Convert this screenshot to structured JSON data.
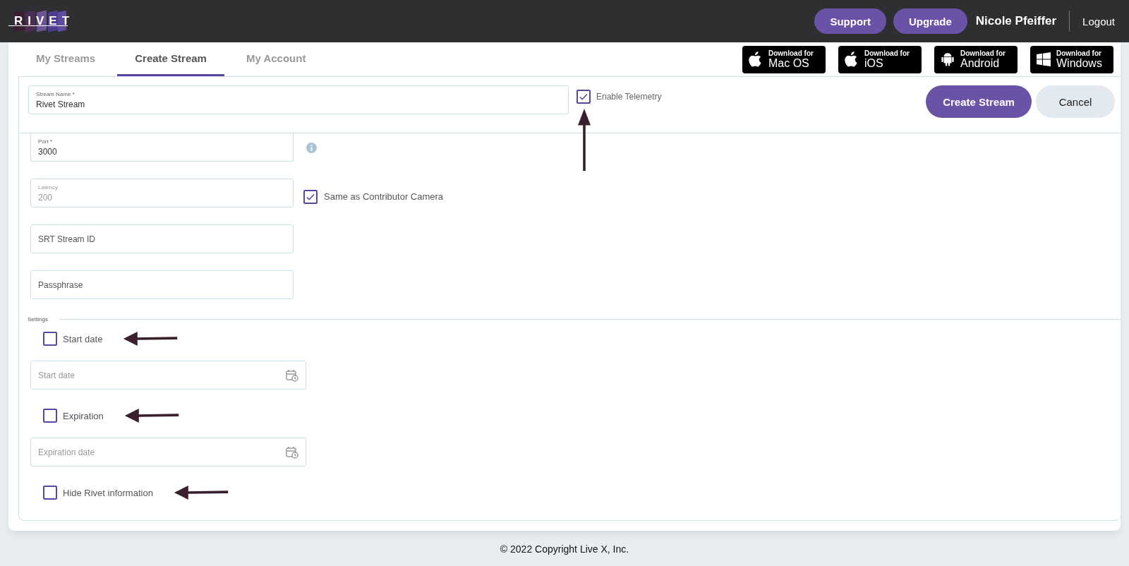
{
  "header": {
    "logo": "RIVET",
    "buttons": [
      {
        "label": "Support"
      },
      {
        "label": "Upgrade"
      }
    ],
    "user_name": "Nicole Pfeiffer",
    "logout": "Logout"
  },
  "tabs": [
    {
      "label": "My Streams",
      "selected": false
    },
    {
      "label": "Create Stream",
      "selected": true
    },
    {
      "label": "My Account",
      "selected": false
    }
  ],
  "downloads": [
    {
      "kind": "apple",
      "line1": "Download for",
      "line2": "Mac OS"
    },
    {
      "kind": "apple",
      "line1": "Download for",
      "line2": "iOS"
    },
    {
      "kind": "android",
      "line1": "Download for",
      "line2": "Android"
    },
    {
      "kind": "windows",
      "line1": "Download for",
      "line2": "Windows"
    }
  ],
  "stream_name": {
    "label": "Stream Name *",
    "value": "Rivet Stream"
  },
  "telemetry": {
    "label": "Enable Telemetry",
    "checked": true
  },
  "actions": [
    {
      "label": "Create Stream",
      "kind": "primary"
    },
    {
      "label": "Cancel",
      "kind": "secondary"
    }
  ],
  "connection_fields": [
    {
      "label": "Port *",
      "value": "3000",
      "disabled": false,
      "info": true
    },
    {
      "label": "Latency",
      "value": "200",
      "disabled": true,
      "option": {
        "label": "Same as Contributor Camera",
        "checked": true
      }
    },
    {
      "placeholder": "SRT Stream ID"
    },
    {
      "placeholder": "Passphrase"
    }
  ],
  "settings": {
    "legend": "Settings",
    "items": [
      {
        "kind": "checkbox",
        "label": "Start date",
        "checked": false
      },
      {
        "kind": "date",
        "placeholder": "Start date"
      },
      {
        "kind": "checkbox",
        "label": "Expiration",
        "checked": false
      },
      {
        "kind": "date",
        "placeholder": "Expiration date"
      },
      {
        "kind": "checkbox",
        "label": "Hide Rivet information",
        "checked": false
      }
    ]
  },
  "footer": "© 2022 Copyright Live X, Inc."
}
